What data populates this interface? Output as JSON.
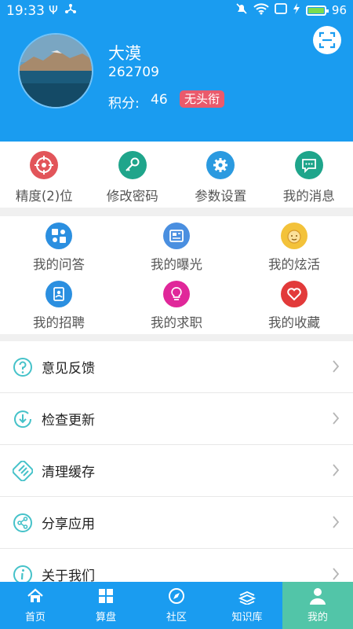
{
  "status_bar": {
    "time": "19:33",
    "battery_level": "96"
  },
  "profile": {
    "name": "大漠",
    "id": "262709",
    "points_label": "积分:",
    "points_value": "46",
    "title_badge": "无头衔"
  },
  "shortcuts": [
    {
      "label": "精度(2)位",
      "icon": "target-icon",
      "color": "#e2555a"
    },
    {
      "label": "修改密码",
      "icon": "key-icon",
      "color": "#1fa58b"
    },
    {
      "label": "参数设置",
      "icon": "gear-icon",
      "color": "#2b9ae0"
    },
    {
      "label": "我的消息",
      "icon": "chat-bubble-icon",
      "color": "#1fa58b"
    }
  ],
  "grid": [
    {
      "label": "我的问答",
      "icon": "qa-icon",
      "color": "#2b8fe0"
    },
    {
      "label": "我的曝光",
      "icon": "newspaper-icon",
      "color": "#4a8fe0"
    },
    {
      "label": "我的炫活",
      "icon": "face-icon",
      "color": "#f3c23a"
    },
    {
      "label": "我的招聘",
      "icon": "id-card-icon",
      "color": "#2b8fe0"
    },
    {
      "label": "我的求职",
      "icon": "lightbulb-icon",
      "color": "#e0279a"
    },
    {
      "label": "我的收藏",
      "icon": "heart-icon",
      "color": "#e23a3a"
    }
  ],
  "menu": [
    {
      "label": "意见反馈",
      "icon": "question-icon"
    },
    {
      "label": "检查更新",
      "icon": "download-icon"
    },
    {
      "label": "清理缓存",
      "icon": "broom-icon"
    },
    {
      "label": "分享应用",
      "icon": "share-icon"
    },
    {
      "label": "关于我们",
      "icon": "info-icon"
    }
  ],
  "bottom_nav": [
    {
      "label": "首页",
      "icon": "home-icon"
    },
    {
      "label": "算盘",
      "icon": "grid-icon"
    },
    {
      "label": "社区",
      "icon": "compass-icon"
    },
    {
      "label": "知识库",
      "icon": "books-icon"
    },
    {
      "label": "我的",
      "icon": "person-icon",
      "active": true
    }
  ],
  "colors": {
    "primary": "#1a9cf0",
    "nav_active": "#52c5a8",
    "badge": "#ea5a6c",
    "accent_icon": "#45c2c9"
  }
}
